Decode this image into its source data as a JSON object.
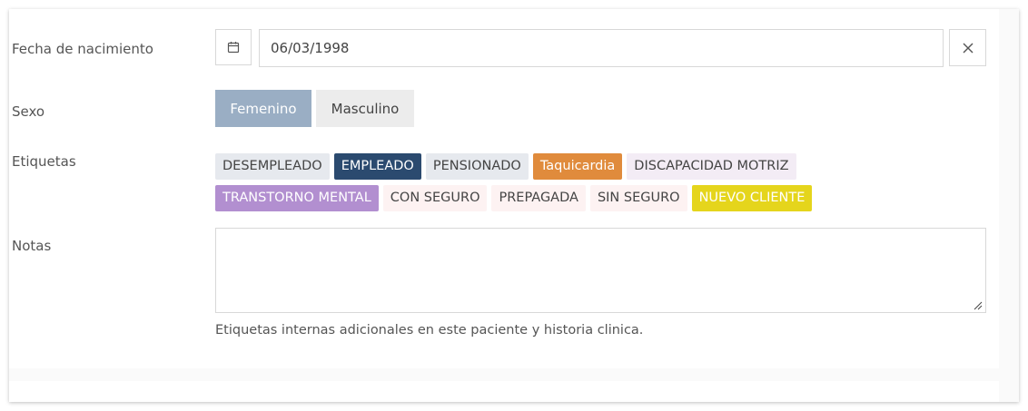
{
  "form": {
    "birthdate": {
      "label": "Fecha de nacimiento",
      "value": "06/03/1998",
      "icon": "calendar-icon",
      "clear_icon": "close-icon"
    },
    "sex": {
      "label": "Sexo",
      "options": [
        "Femenino",
        "Masculino"
      ],
      "selected": "Femenino"
    },
    "tags": {
      "label": "Etiquetas",
      "row1": [
        {
          "text": "DESEMPLEADO",
          "bg": "#e6e9ee",
          "fg": "#444444"
        },
        {
          "text": "EMPLEADO",
          "bg": "#2b4a6f",
          "fg": "#ffffff"
        },
        {
          "text": "PENSIONADO",
          "bg": "#e6e9ee",
          "fg": "#444444"
        },
        {
          "text": "Taquicardia",
          "bg": "#e08b3c",
          "fg": "#ffffff"
        },
        {
          "text": "DISCAPACIDAD MOTRIZ",
          "bg": "#f3ecf5",
          "fg": "#444444"
        }
      ],
      "row2": [
        {
          "text": "TRANSTORNO MENTAL",
          "bg": "#b28fd0",
          "fg": "#ffffff"
        },
        {
          "text": "CON SEGURO",
          "bg": "#fdf2f2",
          "fg": "#444444"
        },
        {
          "text": "PREPAGADA",
          "bg": "#fdf2f2",
          "fg": "#444444"
        },
        {
          "text": "SIN SEGURO",
          "bg": "#fdf2f2",
          "fg": "#444444"
        },
        {
          "text": "NUEVO CLIENTE",
          "bg": "#e5d51c",
          "fg": "#ffffff"
        }
      ]
    },
    "notes": {
      "label": "Notas",
      "value": "",
      "help": "Etiquetas internas adicionales en este paciente y historia clinica."
    }
  }
}
